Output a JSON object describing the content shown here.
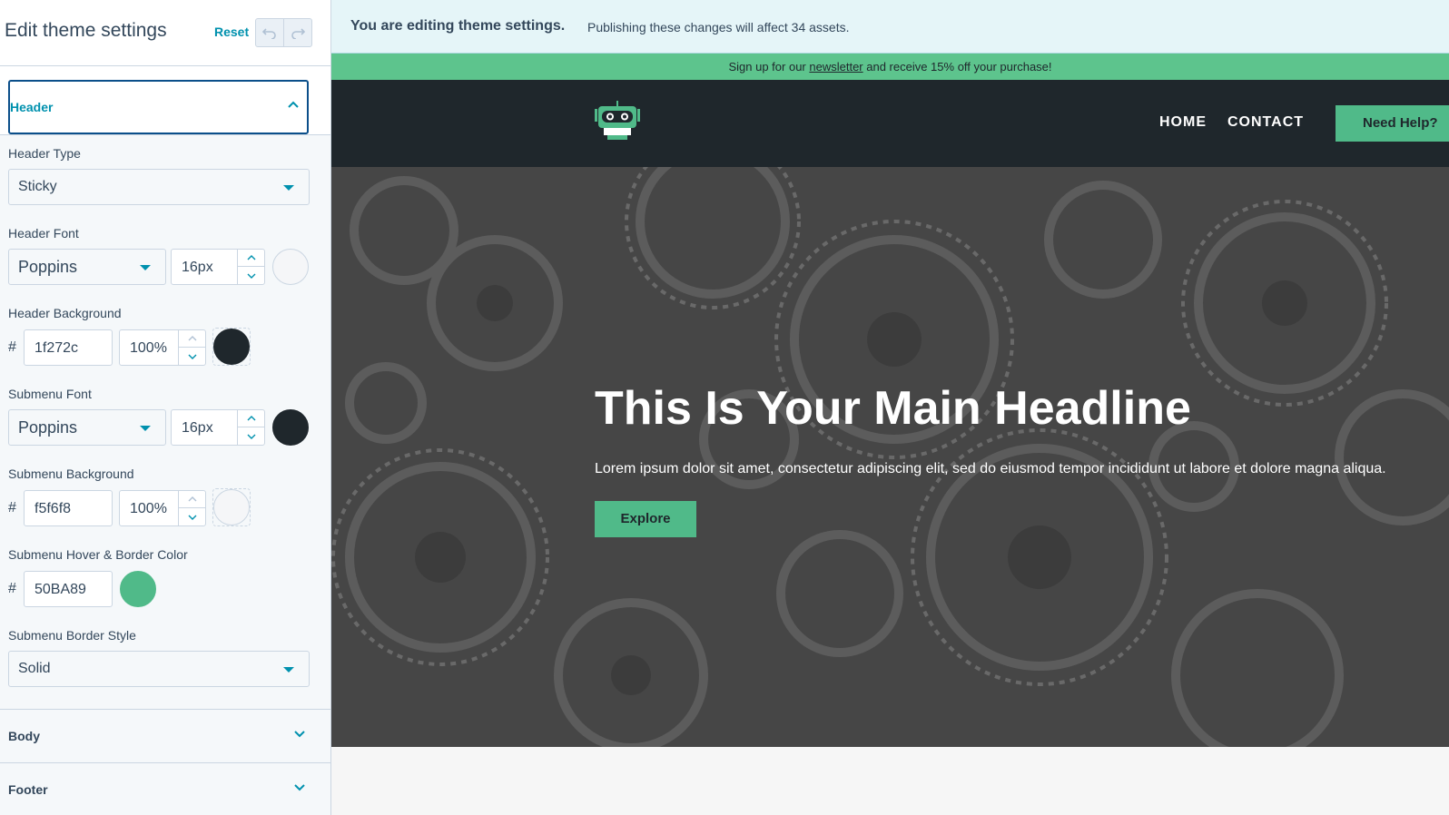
{
  "sidebar": {
    "title": "Edit theme settings",
    "reset_label": "Reset",
    "section_label": "Header",
    "header_type": {
      "label": "Header Type",
      "value": "Sticky"
    },
    "header_font": {
      "label": "Header Font",
      "family": "Poppins",
      "size": "16px",
      "color": "#f5f6f8"
    },
    "header_background": {
      "label": "Header Background",
      "hash": "#",
      "hex": "1f272c",
      "opacity": "100%",
      "color": "#1f272c"
    },
    "submenu_font": {
      "label": "Submenu Font",
      "family": "Poppins",
      "size": "16px",
      "color": "#1f272c"
    },
    "submenu_background": {
      "label": "Submenu Background",
      "hash": "#",
      "hex": "f5f6f8",
      "opacity": "100%",
      "color": "#f5f6f8"
    },
    "submenu_hover": {
      "label": "Submenu Hover & Border Color",
      "hash": "#",
      "hex": "50BA89",
      "color": "#50BA89"
    },
    "submenu_border": {
      "label": "Submenu Border Style",
      "value": "Solid"
    },
    "collapsed_sections": [
      "Body",
      "Footer"
    ]
  },
  "preview": {
    "banner_strong": "You are editing theme settings.",
    "banner_msg": "Publishing these changes will affect 34 assets.",
    "promo_before": "Sign up for our ",
    "promo_link": "newsletter",
    "promo_after": " and receive 15% off your purchase!",
    "nav": [
      "HOME",
      "CONTACT"
    ],
    "help_button": "Need Help?",
    "headline": "This Is Your Main Headline",
    "body": "Lorem ipsum dolor sit amet, consectetur adipiscing elit, sed do eiusmod tempor incididunt ut labore et dolore magna aliqua.",
    "cta": "Explore"
  },
  "colors": {
    "accent": "#0091ae",
    "brand_green": "#50BA89",
    "header_dark": "#1f272c"
  }
}
